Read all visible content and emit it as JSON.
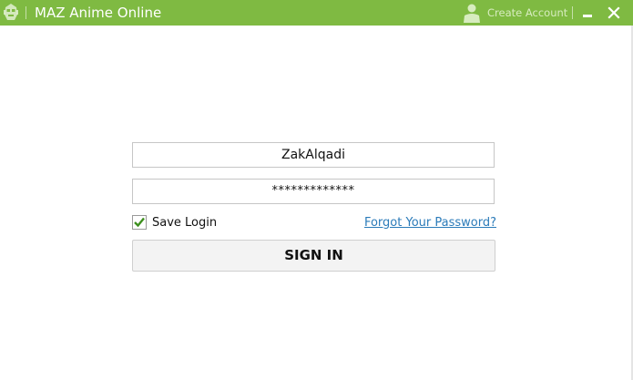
{
  "titlebar": {
    "title": "MAZ Anime Online",
    "create_account": "Create Account",
    "icons": [
      "robot-head-icon",
      "user-icon",
      "minimize-icon",
      "close-icon"
    ]
  },
  "login": {
    "username": "ZakAlqadi",
    "password_masked": "*************",
    "save_login_label": "Save Login",
    "save_login_checked": true,
    "forgot_password": "Forgot Your Password?",
    "sign_in": "SIGN IN"
  },
  "colors": {
    "titlebar": "#7fba42",
    "link": "#2b7bb9",
    "check": "#3d8f1e"
  }
}
